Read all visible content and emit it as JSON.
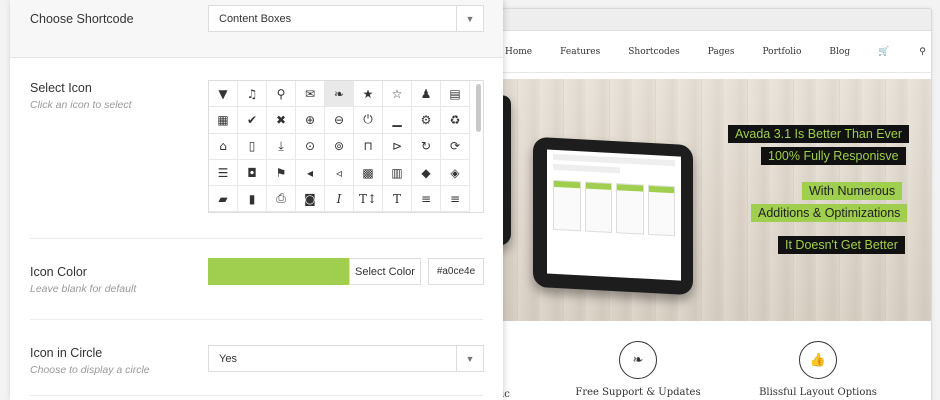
{
  "colors": {
    "accent": "#a0ce4e",
    "dark": "#111111"
  },
  "site": {
    "nav": [
      "Home",
      "Features",
      "Shortcodes",
      "Pages",
      "Portfolio",
      "Blog"
    ],
    "nav_icons": [
      "cart-icon",
      "search-icon"
    ],
    "headlines": [
      {
        "text": "Avada 3.1 Is Better Than Ever",
        "style": "dark"
      },
      {
        "text": "100% Fully Responisve",
        "style": "dark"
      },
      {
        "text": "With Numerous",
        "style": "green"
      },
      {
        "text": "Additions & Optimizations",
        "style": "green"
      },
      {
        "text": "It Doesn't Get Better",
        "style": "dark"
      }
    ],
    "features": [
      {
        "icon": "leaf-icon",
        "label": "Free Support & Updates"
      },
      {
        "icon": "thumbs-up-icon",
        "label": "Blissful Layout Options"
      }
    ],
    "partial_feature_text": "ic"
  },
  "panel": {
    "shortcode": {
      "label": "Choose Shortcode",
      "value": "Content Boxes"
    },
    "select_icon": {
      "label": "Select Icon",
      "hint": "Click an icon to select"
    },
    "icons": [
      {
        "name": "filter-icon",
        "glyph": "▼"
      },
      {
        "name": "music-icon",
        "glyph": "♫"
      },
      {
        "name": "search-icon",
        "glyph": "⚲"
      },
      {
        "name": "envelope-icon",
        "glyph": "✉"
      },
      {
        "name": "leaf-icon",
        "glyph": "❧",
        "selected": true
      },
      {
        "name": "star-icon",
        "glyph": "★"
      },
      {
        "name": "star-empty-icon",
        "glyph": "☆"
      },
      {
        "name": "user-icon",
        "glyph": "♟"
      },
      {
        "name": "film-icon",
        "glyph": "▤"
      },
      {
        "name": "th-large-icon",
        "glyph": "▦"
      },
      {
        "name": "check-icon",
        "glyph": "✔"
      },
      {
        "name": "remove-icon",
        "glyph": "✖"
      },
      {
        "name": "zoom-in-icon",
        "glyph": "⊕"
      },
      {
        "name": "zoom-out-icon",
        "glyph": "⊖"
      },
      {
        "name": "power-icon",
        "glyph": "⏻"
      },
      {
        "name": "signal-icon",
        "glyph": "▁"
      },
      {
        "name": "cog-icon",
        "glyph": "⚙"
      },
      {
        "name": "trash-icon",
        "glyph": "♻"
      },
      {
        "name": "home-icon",
        "glyph": "⌂"
      },
      {
        "name": "file-icon",
        "glyph": "▯"
      },
      {
        "name": "download-icon",
        "glyph": "⤓"
      },
      {
        "name": "download-circle-icon",
        "glyph": "⊙"
      },
      {
        "name": "upload-circle-icon",
        "glyph": "⊚"
      },
      {
        "name": "inbox-icon",
        "glyph": "⊓"
      },
      {
        "name": "play-circle-icon",
        "glyph": "⊳"
      },
      {
        "name": "repeat-icon",
        "glyph": "↻"
      },
      {
        "name": "refresh-icon",
        "glyph": "⟳"
      },
      {
        "name": "list-alt-icon",
        "glyph": "☰"
      },
      {
        "name": "lock-icon",
        "glyph": "◘"
      },
      {
        "name": "flag-icon",
        "glyph": "⚑"
      },
      {
        "name": "volume-down-icon",
        "glyph": "◂"
      },
      {
        "name": "volume-up-icon",
        "glyph": "◃"
      },
      {
        "name": "qrcode-icon",
        "glyph": "▩"
      },
      {
        "name": "barcode-icon",
        "glyph": "▥"
      },
      {
        "name": "tag-icon",
        "glyph": "◆"
      },
      {
        "name": "tags-icon",
        "glyph": "◈"
      },
      {
        "name": "book-icon",
        "glyph": "▰"
      },
      {
        "name": "bookmark-icon",
        "glyph": "▮"
      },
      {
        "name": "print-icon",
        "glyph": "⎙"
      },
      {
        "name": "camera-icon",
        "glyph": "◙"
      },
      {
        "name": "italic-icon",
        "glyph": "I"
      },
      {
        "name": "text-height-icon",
        "glyph": "T↕"
      },
      {
        "name": "text-width-icon",
        "glyph": "T"
      },
      {
        "name": "align-left-icon",
        "glyph": "≡"
      },
      {
        "name": "align-center-icon",
        "glyph": "≡"
      },
      {
        "name": "align-right-icon",
        "glyph": "≡"
      },
      {
        "name": "align-justify-icon",
        "glyph": "≣"
      },
      {
        "name": "list-icon",
        "glyph": "☷"
      },
      {
        "name": "indent-left-icon",
        "glyph": "⇤"
      },
      {
        "name": "indent-right-icon",
        "glyph": "⇥"
      }
    ],
    "icon_color": {
      "label": "Icon Color",
      "hint": "Leave blank for default",
      "button": "Select Color",
      "value": "#a0ce4e"
    },
    "icon_in_circle": {
      "label": "Icon in Circle",
      "hint": "Choose to display a circle",
      "value": "Yes"
    }
  }
}
